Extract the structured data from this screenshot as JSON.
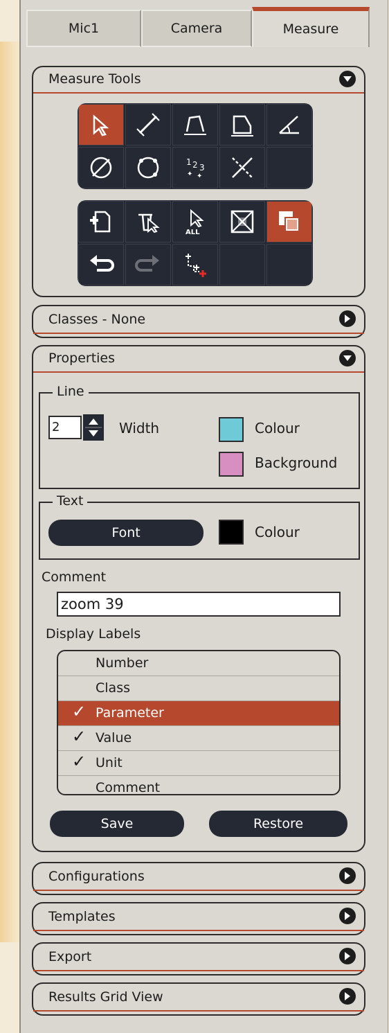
{
  "tabs": [
    "Mic1",
    "Camera",
    "Measure"
  ],
  "measure_tools": {
    "title": "Measure Tools"
  },
  "classes": {
    "title": "Classes - None"
  },
  "properties": {
    "title": "Properties",
    "line": {
      "label": "Line",
      "width_value": "2",
      "width_label": "Width",
      "colour_label": "Colour",
      "background_label": "Background",
      "colour": "#6dcad6",
      "background": "#d78fc2"
    },
    "text": {
      "label": "Text",
      "font_button": "Font",
      "colour_label": "Colour",
      "colour": "#000000"
    },
    "comment_label": "Comment",
    "comment_value": "zoom 39",
    "display_labels_title": "Display Labels",
    "display_labels": [
      {
        "label": "Number",
        "checked": false,
        "selected": false
      },
      {
        "label": "Class",
        "checked": false,
        "selected": false
      },
      {
        "label": "Parameter",
        "checked": true,
        "selected": true
      },
      {
        "label": "Value",
        "checked": true,
        "selected": false
      },
      {
        "label": "Unit",
        "checked": true,
        "selected": false
      },
      {
        "label": "Comment",
        "checked": false,
        "selected": false
      }
    ],
    "save": "Save",
    "restore": "Restore"
  },
  "sections": [
    "Configurations",
    "Templates",
    "Export",
    "Results Grid View"
  ],
  "colors": {
    "accent": "#b5482d",
    "dark": "#252933",
    "panel": "#dad8d1"
  }
}
